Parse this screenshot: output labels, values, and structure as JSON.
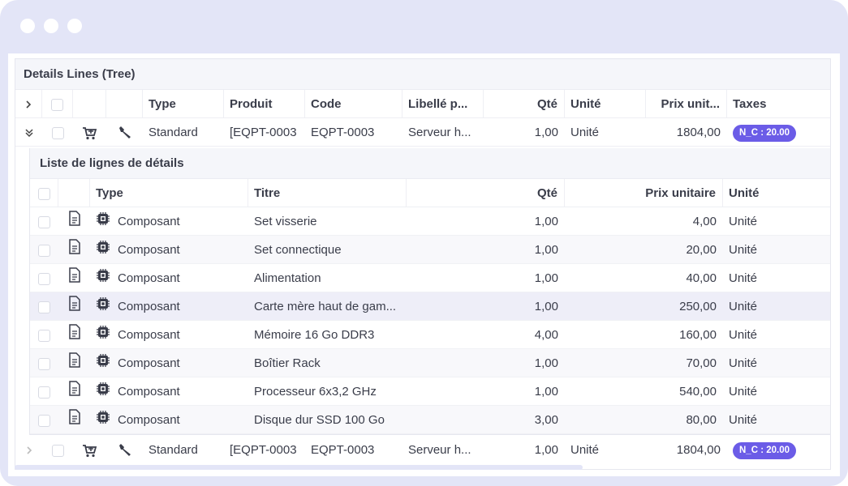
{
  "tree": {
    "title": "Details Lines (Tree)",
    "columns": {
      "type": "Type",
      "produit": "Produit",
      "code": "Code",
      "libelle": "Libellé p...",
      "qte": "Qté",
      "unite": "Unité",
      "prix": "Prix unit...",
      "taxes": "Taxes"
    },
    "rows": [
      {
        "type": "Standard",
        "produit": "[EQPT-0003",
        "code": "EQPT-0003",
        "libelle": "Serveur h...",
        "qte": "1,00",
        "unite": "Unité",
        "prix": "1804,00",
        "taxe": "N_C : 20.00",
        "expanded": true
      },
      {
        "type": "Standard",
        "produit": "[EQPT-0003",
        "code": "EQPT-0003",
        "libelle": "Serveur h...",
        "qte": "1,00",
        "unite": "Unité",
        "prix": "1804,00",
        "taxe": "N_C : 20.00",
        "expanded": false
      }
    ]
  },
  "sublist": {
    "title": "Liste de lignes de détails",
    "columns": {
      "type": "Type",
      "titre": "Titre",
      "qte": "Qté",
      "prix": "Prix unitaire",
      "unite": "Unité"
    },
    "items": [
      {
        "type": "Composant",
        "titre": "Set visserie",
        "qte": "1,00",
        "prix": "4,00",
        "unite": "Unité"
      },
      {
        "type": "Composant",
        "titre": "Set connectique",
        "qte": "1,00",
        "prix": "20,00",
        "unite": "Unité"
      },
      {
        "type": "Composant",
        "titre": "Alimentation",
        "qte": "1,00",
        "prix": "40,00",
        "unite": "Unité"
      },
      {
        "type": "Composant",
        "titre": "Carte mère haut de gam...",
        "qte": "1,00",
        "prix": "250,00",
        "unite": "Unité"
      },
      {
        "type": "Composant",
        "titre": "Mémoire 16 Go DDR3",
        "qte": "4,00",
        "prix": "160,00",
        "unite": "Unité"
      },
      {
        "type": "Composant",
        "titre": "Boîtier Rack",
        "qte": "1,00",
        "prix": "70,00",
        "unite": "Unité"
      },
      {
        "type": "Composant",
        "titre": "Processeur 6x3,2 GHz",
        "qte": "1,00",
        "prix": "540,00",
        "unite": "Unité"
      },
      {
        "type": "Composant",
        "titre": "Disque dur SSD 100 Go",
        "qte": "3,00",
        "prix": "80,00",
        "unite": "Unité"
      }
    ]
  },
  "colors": {
    "accent": "#6b5ce7",
    "frame": "#e3e5f7",
    "icon": "#3a3d4a"
  }
}
